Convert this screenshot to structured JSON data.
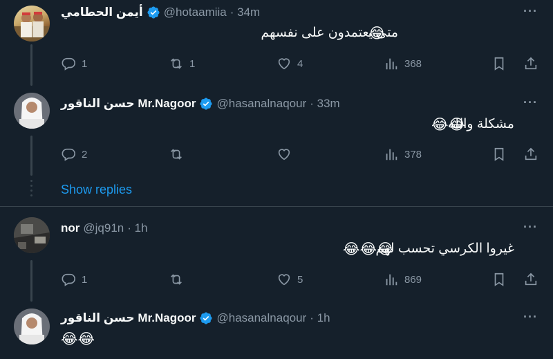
{
  "tweets": [
    {
      "name": "أيمن الحطامي",
      "handle": "@hotaamiia",
      "time": "· 34m",
      "text": "متى يعتمدون على نفسهم",
      "emojis": "😂",
      "replies": "1",
      "retweets": "1",
      "likes": "4",
      "views": "368"
    },
    {
      "name_ar": "حسن الناقور",
      "name": "Mr.Nagoor",
      "handle": "@hasanalnaqour",
      "time": "· 33m",
      "text": "مشكلة والله",
      "emojis": "😂😂",
      "replies": "2",
      "retweets": "",
      "likes": "",
      "views": "378"
    },
    {
      "name": "nor",
      "handle": "@jq91n",
      "time": "· 1h",
      "text": "غيروا الكرسي تحسب لهم",
      "emojis": "😂😂😂",
      "replies": "1",
      "retweets": "",
      "likes": "5",
      "views": "869"
    },
    {
      "name_ar": "حسن الناقور",
      "name": "Mr.Nagoor",
      "handle": "@hasanalnaqour",
      "time": "· 1h",
      "text": "",
      "emojis": "😂😂"
    }
  ],
  "show_replies": "Show replies",
  "more_label": "···",
  "colors": {
    "background": "#15202b",
    "accent": "#1d9bf0",
    "secondary_text": "#8b98a5",
    "border": "#38444d"
  },
  "icons": [
    "reply-icon",
    "retweet-icon",
    "like-icon",
    "views-icon",
    "bookmark-icon",
    "share-icon",
    "verified-badge-icon",
    "more-icon"
  ]
}
